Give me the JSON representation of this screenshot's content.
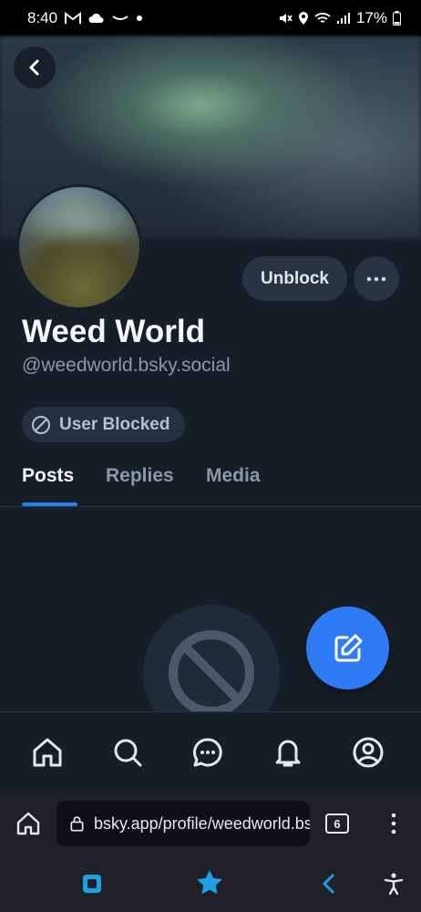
{
  "status_bar": {
    "time": "8:40",
    "battery": "17%",
    "left_icons": [
      "gmail-icon",
      "cloud-icon",
      "amazon-icon",
      "dot-icon"
    ],
    "right_icons": [
      "mute-icon",
      "location-icon",
      "wifi-icon",
      "signal-icon",
      "battery-icon"
    ]
  },
  "profile": {
    "display_name": "Weed World",
    "handle": "@weedworld.bsky.social",
    "blocked_label": "User Blocked",
    "unblock_label": "Unblock"
  },
  "tabs": [
    {
      "label": "Posts",
      "active": true
    },
    {
      "label": "Replies",
      "active": false
    },
    {
      "label": "Media",
      "active": false
    }
  ],
  "bottom_nav": [
    "home-icon",
    "search-icon",
    "chat-icon",
    "bell-icon",
    "profile-icon"
  ],
  "browser": {
    "url": "bsky.app/profile/weedworld.bsky.social",
    "tab_count": "6"
  },
  "colors": {
    "background": "#161e27",
    "accent": "#1f84f0",
    "fab": "#2e7bf5",
    "pill": "#233140",
    "button": "#283441"
  }
}
